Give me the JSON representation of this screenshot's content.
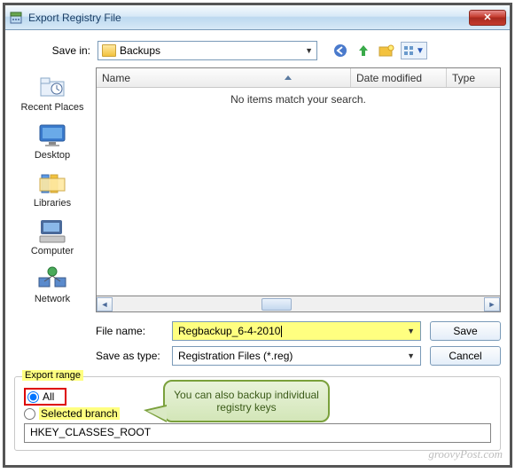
{
  "title": "Export Registry File",
  "saveIn": {
    "label": "Save in:",
    "value": "Backups"
  },
  "navIcons": {
    "back": "back-icon",
    "up": "up-icon",
    "newFolder": "new-folder-icon",
    "views": "views-icon"
  },
  "places": [
    {
      "id": "recent",
      "label": "Recent Places"
    },
    {
      "id": "desktop",
      "label": "Desktop"
    },
    {
      "id": "libraries",
      "label": "Libraries"
    },
    {
      "id": "computer",
      "label": "Computer"
    },
    {
      "id": "network",
      "label": "Network"
    }
  ],
  "columns": {
    "name": "Name",
    "date": "Date modified",
    "type": "Type"
  },
  "emptyMsg": "No items match your search.",
  "fileName": {
    "label": "File name:",
    "value": "Regbackup_6-4-2010"
  },
  "saveType": {
    "label": "Save as type:",
    "value": "Registration Files (*.reg)"
  },
  "buttons": {
    "save": "Save",
    "cancel": "Cancel"
  },
  "exportRange": {
    "legend": "Export range",
    "all": "All",
    "selected": "Selected branch",
    "branch": "HKEY_CLASSES_ROOT"
  },
  "callout": "You can also backup individual registry keys",
  "watermark": "groovyPost.com"
}
